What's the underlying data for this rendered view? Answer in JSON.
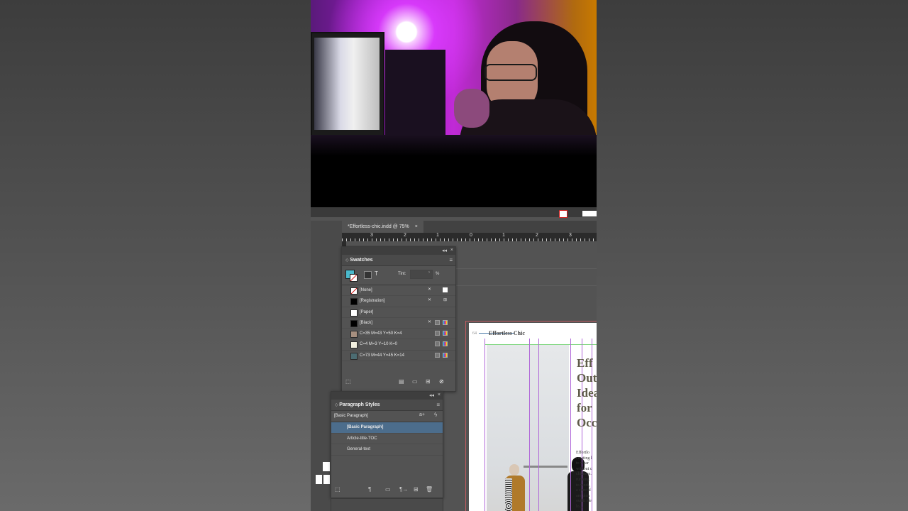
{
  "document_tab": {
    "title": "*Effortless-chic.indd @ 75%",
    "close_icon": "×"
  },
  "ruler": {
    "labels": [
      "3",
      "2",
      "1",
      "0",
      "1",
      "2",
      "3"
    ]
  },
  "swatches_panel": {
    "title": "Swatches",
    "collapse_icon": "◂◂",
    "close_icon": "×",
    "tint_label": "Tint:",
    "tint_value": "",
    "tint_unit": "%",
    "fill_color": "#4ab9cc",
    "text_toggle": "T",
    "items": [
      {
        "name": "[None]",
        "chip": "none"
      },
      {
        "name": "[Registration]",
        "chip": "#000000"
      },
      {
        "name": "[Paper]",
        "chip": "#ffffff"
      },
      {
        "name": "[Black]",
        "chip": "#000000"
      },
      {
        "name": "C=35 M=43 Y=50 K=4",
        "chip": "#a68f7f"
      },
      {
        "name": "C=4 M=3 Y=10 K=0",
        "chip": "#f2f0e0"
      },
      {
        "name": "C=73 M=44 Y=45 K=14",
        "chip": "#4c6c72"
      }
    ]
  },
  "paragraph_styles_panel": {
    "title": "Paragraph Styles",
    "current_style": "[Basic Paragraph]",
    "items": [
      {
        "name": "[Basic Paragraph]",
        "selected": true
      },
      {
        "name": "Article-title-TOC",
        "selected": false
      },
      {
        "name": "General-text",
        "selected": false
      }
    ]
  },
  "page": {
    "running_head": "Effortless Chic",
    "page_number": "64",
    "title_lines": [
      "Eff",
      "Out",
      "Idea",
      "for",
      "Occ"
    ],
    "body_text": "Effortlo\ncreating l\nto wear\nwithout c\nchicness.\nrunning\nto work, \na special\nare plen\noutfit ide\nlo..."
  },
  "colors": {
    "ui_bg": "#535353",
    "selection": "#4c6d8c",
    "page_border": "#c25b60",
    "guide_purple": "#b067d8",
    "guide_green": "#7dd67d"
  }
}
